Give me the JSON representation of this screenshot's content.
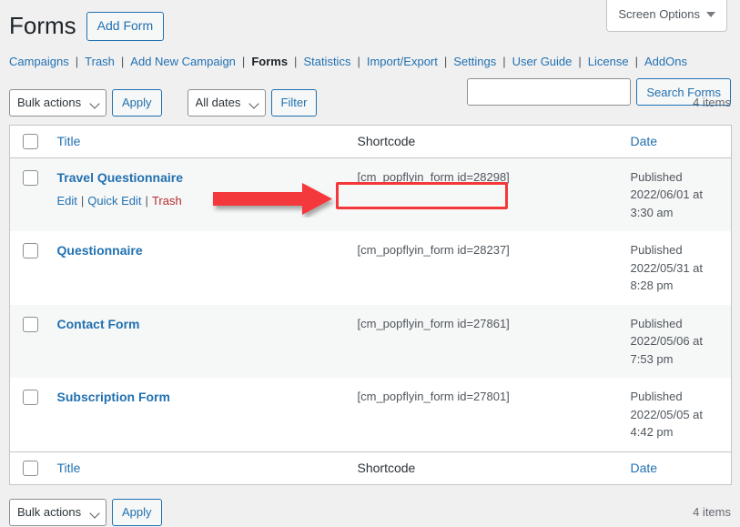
{
  "screen_meta": {
    "screen_options_label": "Screen Options"
  },
  "header": {
    "title": "Forms",
    "add_new_label": "Add Form"
  },
  "subnav": {
    "items": [
      {
        "label": "Campaigns",
        "current": false
      },
      {
        "label": "Trash",
        "current": false
      },
      {
        "label": "Add New Campaign",
        "current": false
      },
      {
        "label": "Forms",
        "current": true
      },
      {
        "label": "Statistics",
        "current": false
      },
      {
        "label": "Import/Export",
        "current": false
      },
      {
        "label": "Settings",
        "current": false
      },
      {
        "label": "User Guide",
        "current": false
      },
      {
        "label": "License",
        "current": false
      },
      {
        "label": "AddOns",
        "current": false
      }
    ],
    "separator": "|"
  },
  "search": {
    "value": "",
    "placeholder": "",
    "submit_label": "Search Forms"
  },
  "tablenav_top": {
    "bulk_actions_selected": "Bulk actions",
    "apply_label": "Apply",
    "dates_selected": "All dates",
    "filter_label": "Filter",
    "displaying_num": "4 items"
  },
  "tablenav_bottom": {
    "bulk_actions_selected": "Bulk actions",
    "apply_label": "Apply",
    "displaying_num": "4 items"
  },
  "table": {
    "columns": {
      "title": "Title",
      "shortcode": "Shortcode",
      "date": "Date"
    },
    "rows": [
      {
        "title": "Travel Questionnaire",
        "shortcode": "[cm_popflyin_form id=28298]",
        "date_status": "Published",
        "date_value": "2022/06/01 at",
        "date_time": "3:30 am",
        "actions": {
          "edit": "Edit",
          "quick_edit": "Quick Edit",
          "trash": "Trash",
          "separator": "|"
        }
      },
      {
        "title": "Questionnaire",
        "shortcode": "[cm_popflyin_form id=28237]",
        "date_status": "Published",
        "date_value": "2022/05/31 at",
        "date_time": "8:28 pm",
        "actions": null
      },
      {
        "title": "Contact Form",
        "shortcode": "[cm_popflyin_form id=27861]",
        "date_status": "Published",
        "date_value": "2022/05/06 at",
        "date_time": "7:53 pm",
        "actions": null
      },
      {
        "title": "Subscription Form",
        "shortcode": "[cm_popflyin_form id=27801]",
        "date_status": "Published",
        "date_value": "2022/05/05 at",
        "date_time": "4:42 pm",
        "actions": null
      }
    ]
  },
  "annotation": {
    "arrow_color": "#f4383a",
    "highlight_color": "#f4383a",
    "target": "[cm_popflyin_form id=28298]"
  },
  "colors": {
    "link": "#2271b1",
    "page_bg": "#f0f0f1",
    "row_alt_bg": "#f6f7f7",
    "trash_link": "#b32d2e"
  }
}
